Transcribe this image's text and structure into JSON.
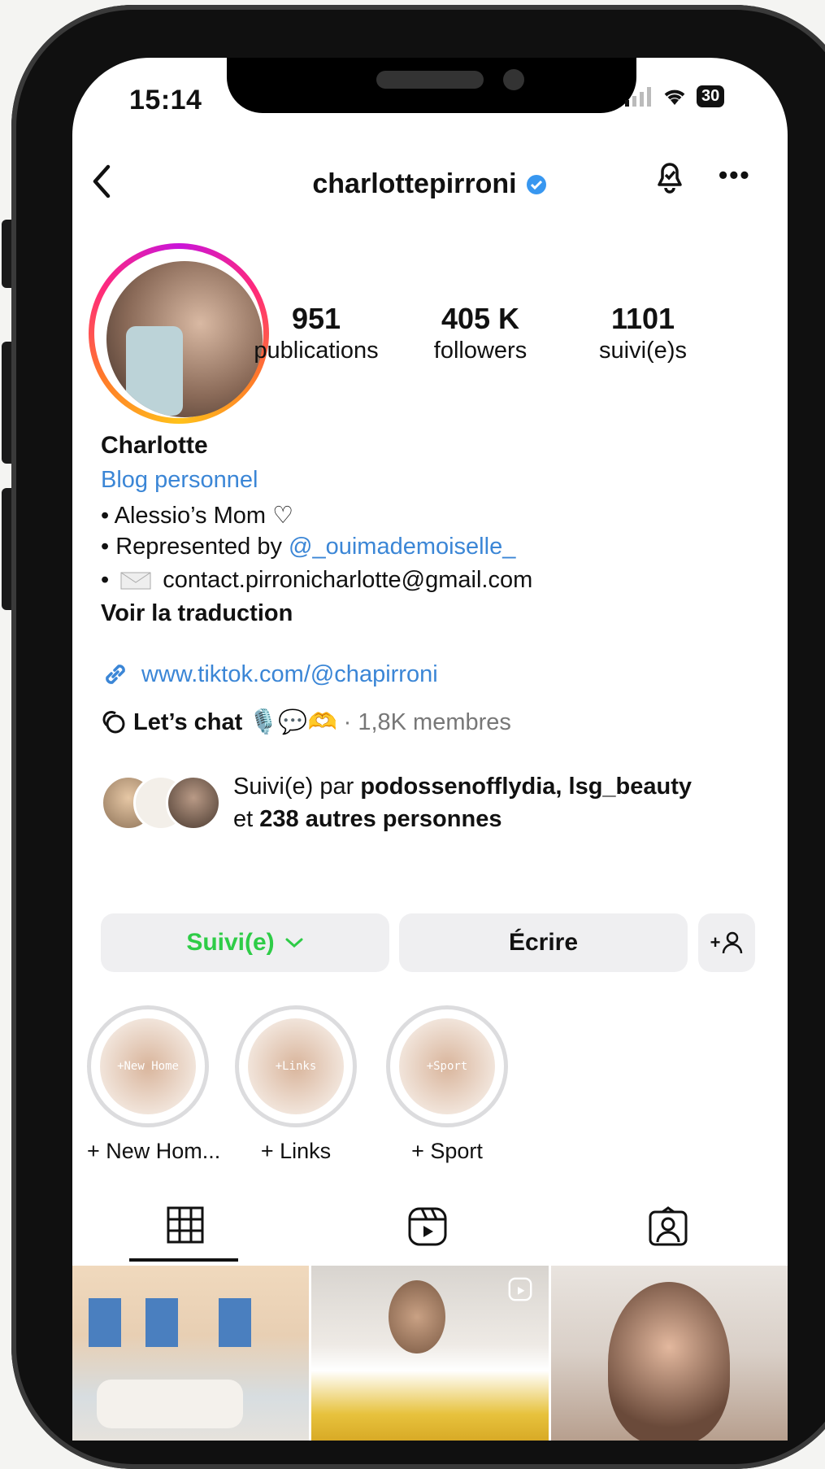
{
  "status_bar": {
    "time": "15:14",
    "battery": "30"
  },
  "header": {
    "username": "charlottepirroni",
    "verified": true
  },
  "stats": [
    {
      "value": "951",
      "label": "publications"
    },
    {
      "value": "405 K",
      "label": "followers"
    },
    {
      "value": "1101",
      "label": "suivi(e)s"
    }
  ],
  "bio": {
    "name": "Charlotte",
    "category": "Blog personnel",
    "line1": "• Alessio’s Mom ♡",
    "line2_prefix": "• Represented by ",
    "line2_mention": "@_ouimademoiselle_",
    "line3_prefix": "• ",
    "line3_email": "contact.pirronicharlotte@gmail.com",
    "translate": "Voir la traduction",
    "website": "www.tiktok.com/@chapirroni"
  },
  "chat": {
    "label": "Let’s chat",
    "emojis": "🎙️💬🫶",
    "members": "· 1,8K membres"
  },
  "followed_by": {
    "prefix": "Suivi(e) par ",
    "names": "podossenofflydia, lsg_beauty",
    "and": "et ",
    "others": "238 autres personnes"
  },
  "actions": {
    "following": "Suivi(e)",
    "message": "Écrire",
    "add_person": "+"
  },
  "highlights": [
    {
      "label": "+ New Hom...",
      "cover_text": "+New Home"
    },
    {
      "label": "+ Links",
      "cover_text": "+Links"
    },
    {
      "label": "+ Sport",
      "cover_text": "+Sport"
    }
  ],
  "colors": {
    "link": "#3b86d6",
    "following_green": "#2ecc47",
    "verified": "#3897f0"
  }
}
